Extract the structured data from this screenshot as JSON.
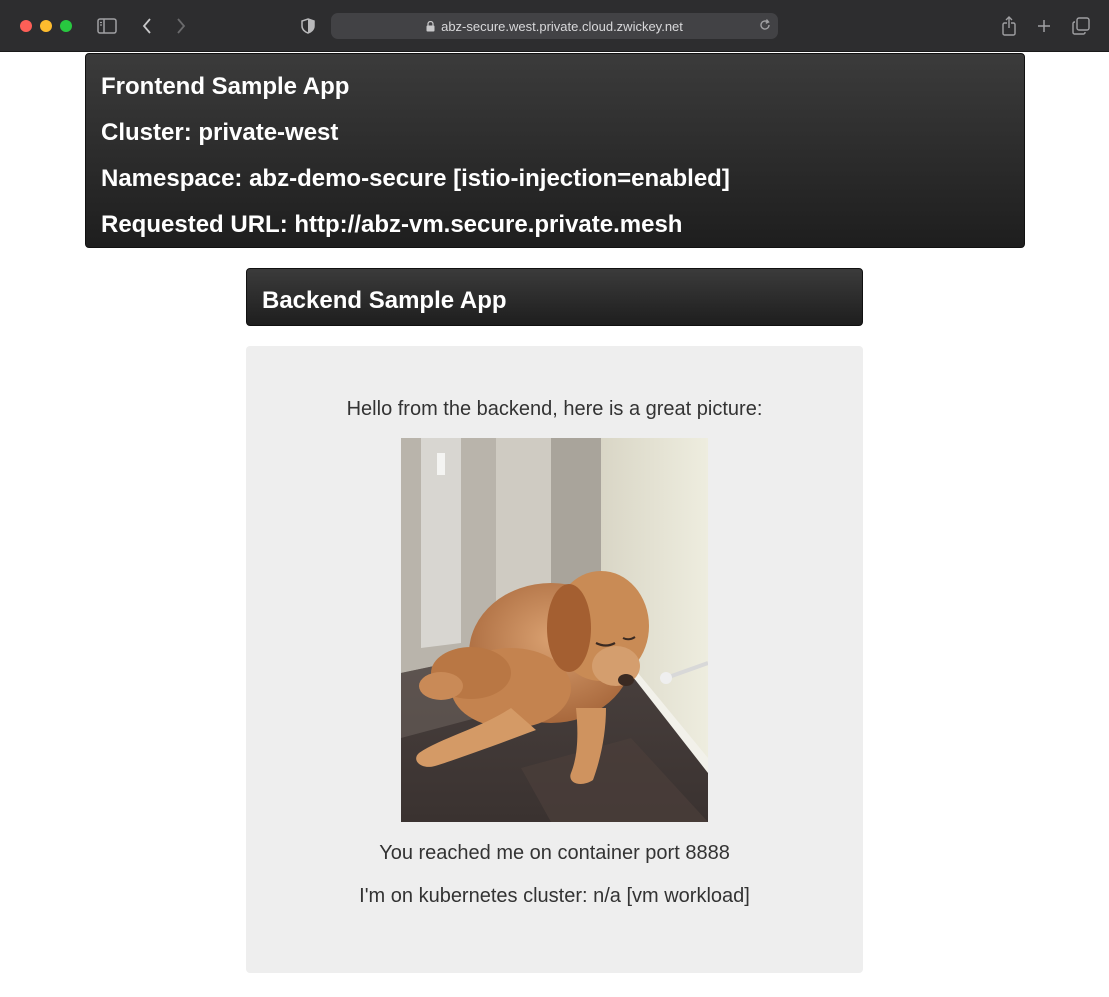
{
  "browser": {
    "url": "abz-secure.west.private.cloud.zwickey.net",
    "icons": [
      "sidebar-icon",
      "back-icon",
      "forward-icon",
      "shield-icon",
      "lock-icon",
      "reload-icon",
      "share-icon",
      "new-tab-icon",
      "tabs-overview-icon"
    ]
  },
  "frontend": {
    "title": "Frontend Sample App",
    "cluster": "Cluster: private-west",
    "namespace": "Namespace: abz-demo-secure [istio-injection=enabled]",
    "requested_url": "Requested URL: http://abz-vm.secure.private.mesh"
  },
  "backend": {
    "title": "Backend Sample App",
    "greeting": "Hello from the backend, here is a great picture:",
    "photo_subject": "puppy-photo",
    "port_line": "You reached me on container port 8888",
    "cluster_line": "I'm on kubernetes cluster: n/a [vm workload]"
  },
  "colors": {
    "header_bg": "#2a2a2a",
    "panel_bg": "#eeeeee",
    "chrome_bg": "#2d2d2f"
  }
}
